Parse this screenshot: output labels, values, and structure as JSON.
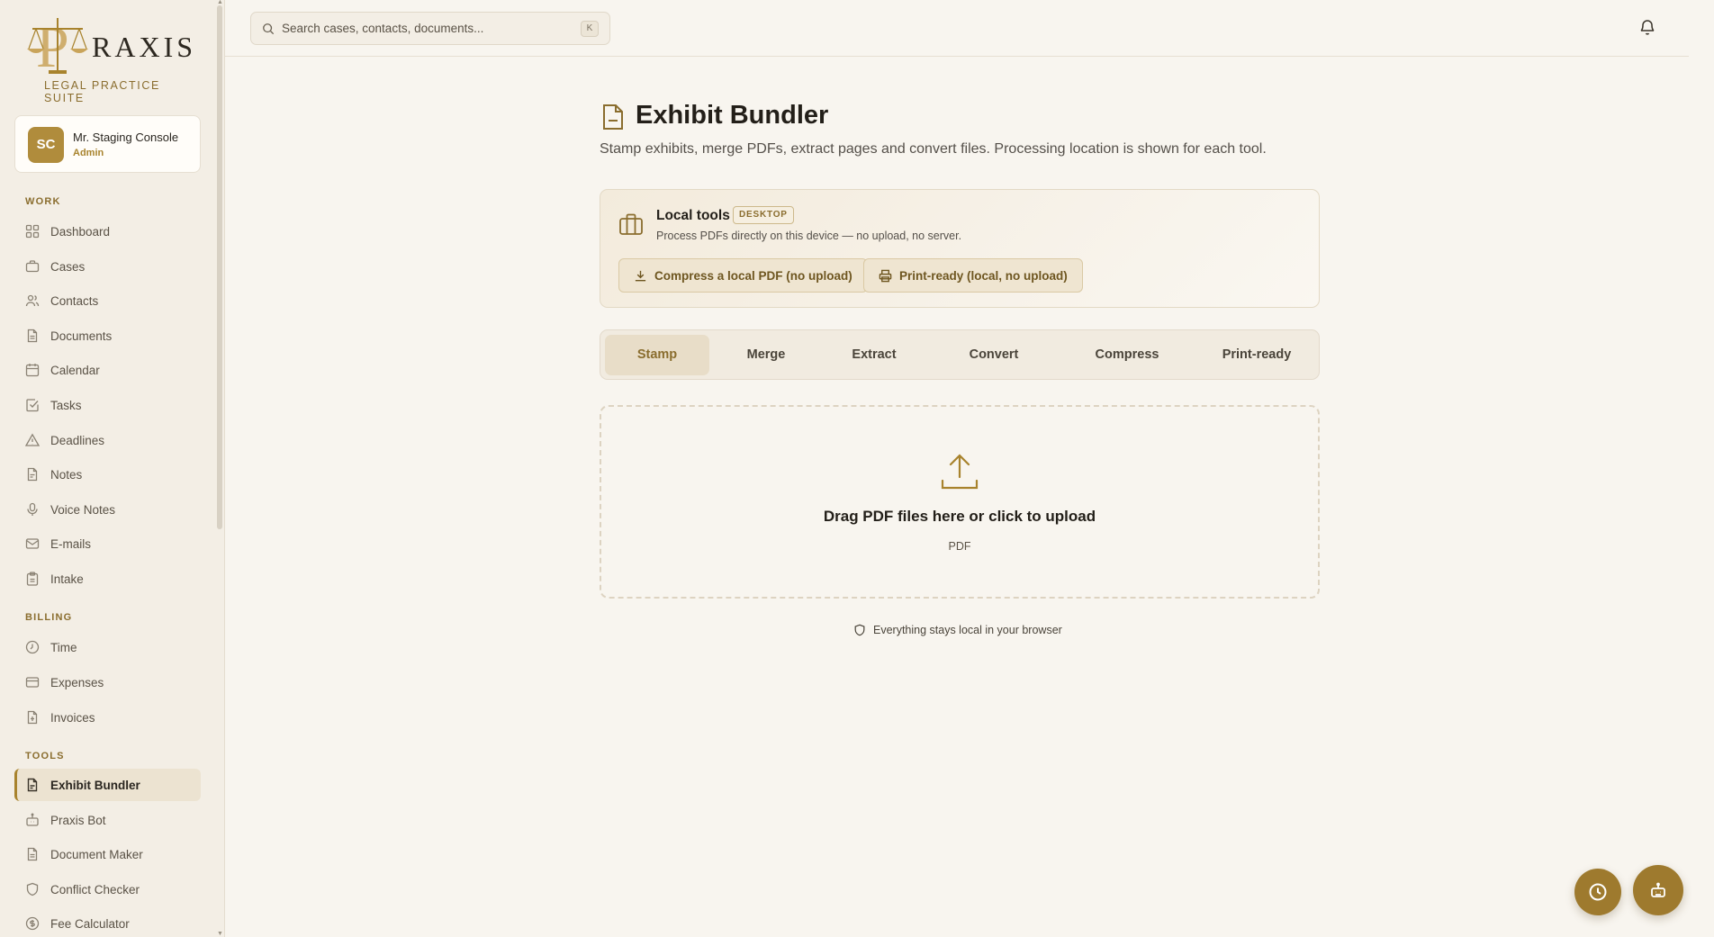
{
  "brand": {
    "name": "RAXIS",
    "tagline": "LEGAL PRACTICE SUITE",
    "accent": "#a8832d"
  },
  "user": {
    "initials": "SC",
    "name": "Mr. Staging Console",
    "role": "Admin"
  },
  "sidebar": {
    "sections": [
      {
        "label": "WORK",
        "items": [
          "Dashboard",
          "Cases",
          "Contacts",
          "Documents",
          "Calendar",
          "Tasks",
          "Deadlines",
          "Notes",
          "Voice Notes",
          "E-mails",
          "Intake"
        ]
      },
      {
        "label": "BILLING",
        "items": [
          "Time",
          "Expenses",
          "Invoices"
        ]
      },
      {
        "label": "TOOLS",
        "items": [
          "Exhibit Bundler",
          "Praxis Bot",
          "Document Maker",
          "Conflict Checker",
          "Fee Calculator"
        ]
      }
    ],
    "active": "Exhibit Bundler"
  },
  "topbar": {
    "search_placeholder": "Search cases, contacts, documents...",
    "shortcut": "K"
  },
  "page": {
    "title": "Exhibit Bundler",
    "description": "Stamp exhibits, merge PDFs, extract pages and convert files. Processing location is shown for each tool."
  },
  "local_tools": {
    "title": "Local tools",
    "badge": "DESKTOP",
    "description": "Process PDFs directly on this device — no upload, no server.",
    "compress_button": "Compress a local PDF (no upload)",
    "print_button": "Print-ready (local, no upload)"
  },
  "tabs": [
    "Stamp",
    "Merge",
    "Extract",
    "Convert",
    "Compress",
    "Print-ready"
  ],
  "active_tab": "Stamp",
  "dropzone": {
    "title": "Drag PDF files here or click to upload",
    "accepted": "PDF"
  },
  "local_note": "Everything stays local in your browser"
}
